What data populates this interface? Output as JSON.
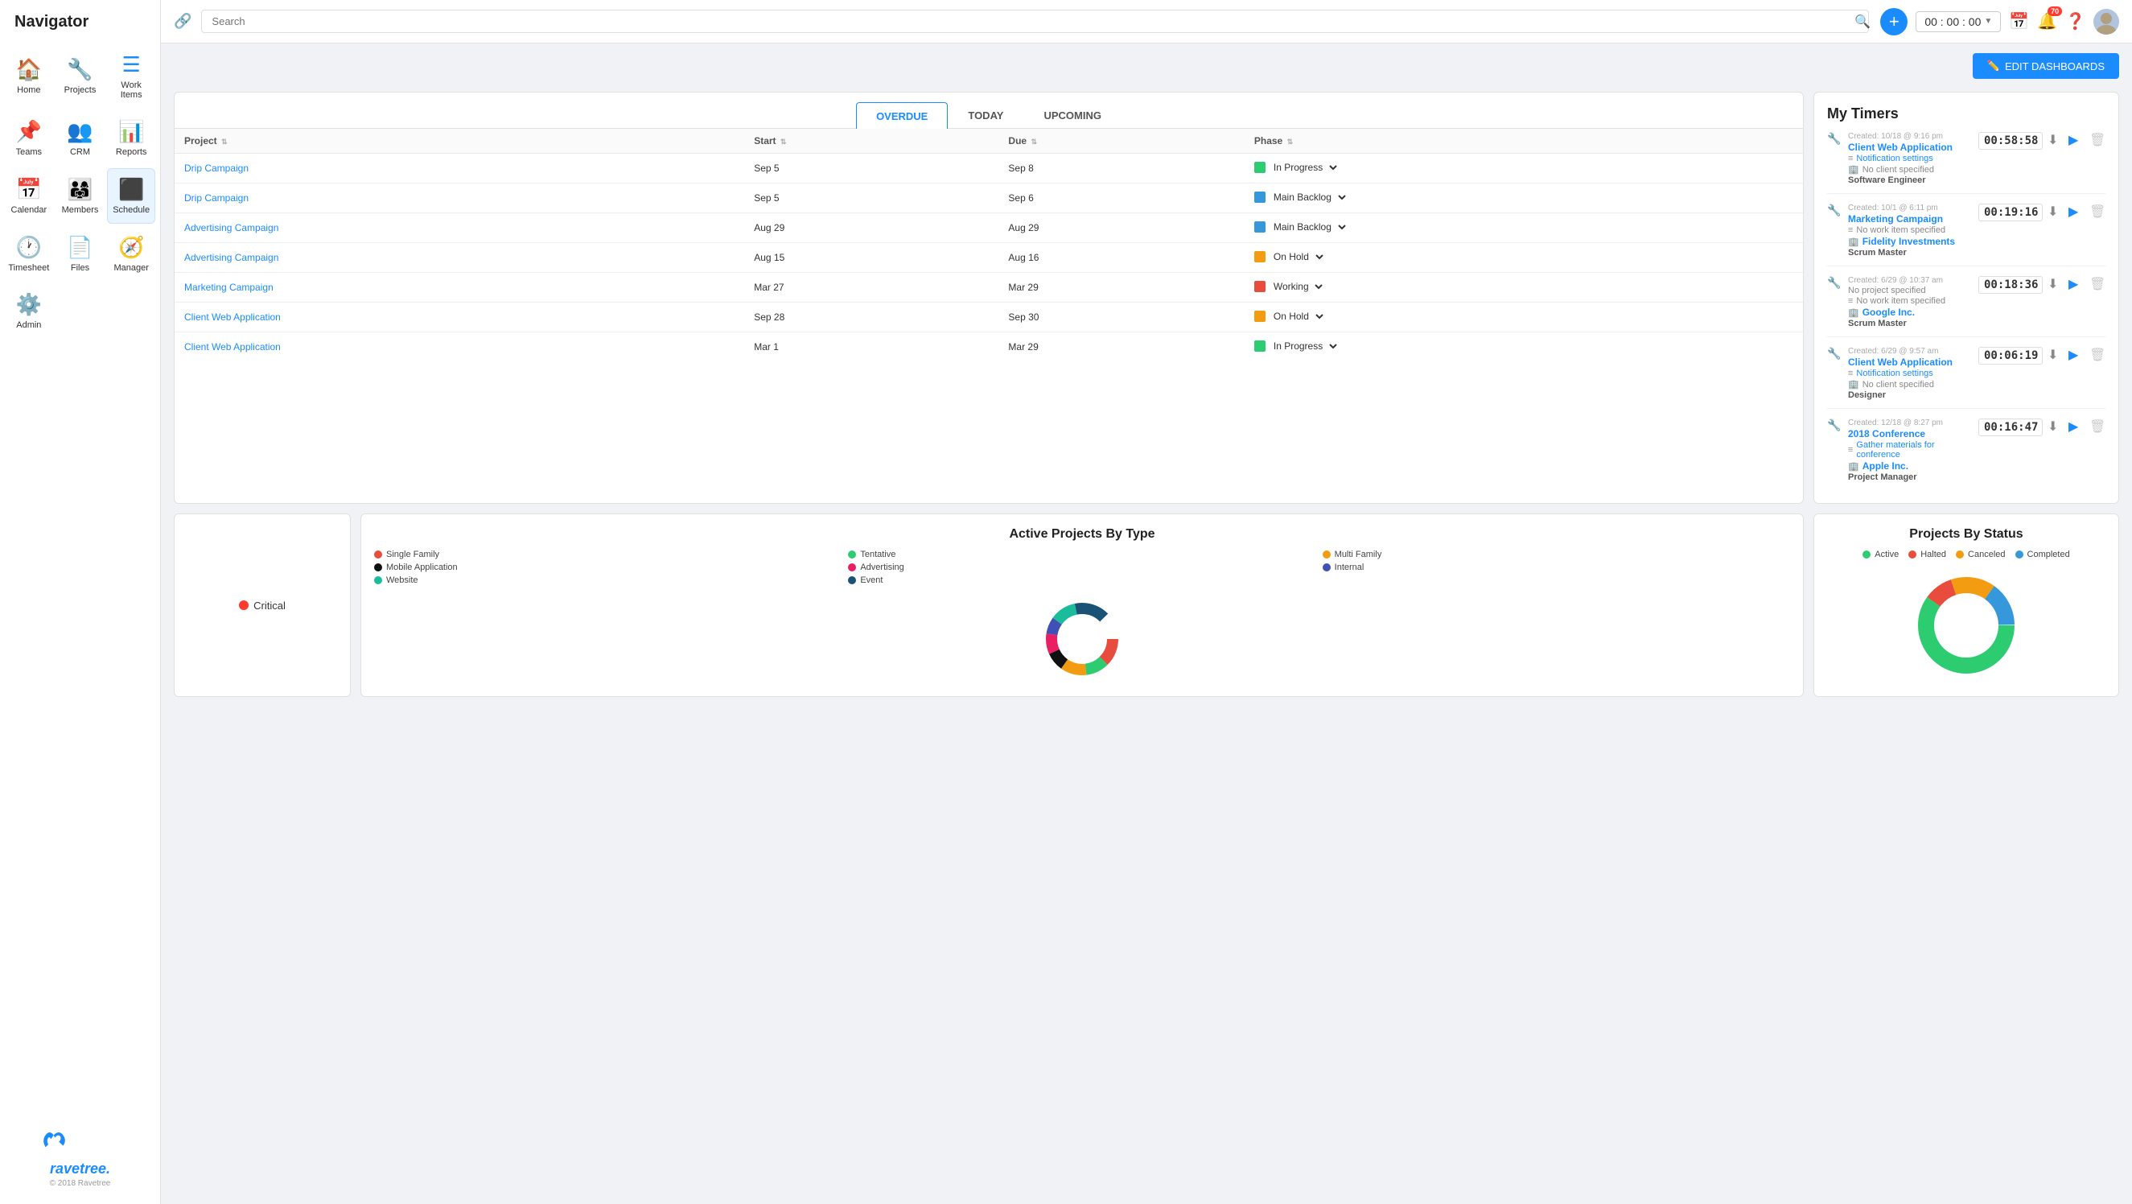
{
  "app": {
    "title": "Navigator"
  },
  "sidebar": {
    "items": [
      {
        "id": "home",
        "label": "Home",
        "icon": "🏠"
      },
      {
        "id": "projects",
        "label": "Projects",
        "icon": "🔧"
      },
      {
        "id": "work-items",
        "label": "Work Items",
        "icon": "☰"
      },
      {
        "id": "teams",
        "label": "Teams",
        "icon": "📌"
      },
      {
        "id": "crm",
        "label": "CRM",
        "icon": "👥"
      },
      {
        "id": "reports",
        "label": "Reports",
        "icon": "📊"
      },
      {
        "id": "calendar",
        "label": "Calendar",
        "icon": "📅"
      },
      {
        "id": "members",
        "label": "Members",
        "icon": "👨‍👩‍👧"
      },
      {
        "id": "schedule",
        "label": "Schedule",
        "icon": "⬛"
      },
      {
        "id": "timesheet",
        "label": "Timesheet",
        "icon": "🕐"
      },
      {
        "id": "files",
        "label": "Files",
        "icon": "📄"
      },
      {
        "id": "manager",
        "label": "Manager",
        "icon": "🧭"
      },
      {
        "id": "admin",
        "label": "Admin",
        "icon": "⚙️"
      }
    ],
    "footer": {
      "logo": "ravetree.",
      "copyright": "© 2018 Ravetree"
    }
  },
  "topbar": {
    "search_placeholder": "Search",
    "timer": "00 : 00 : 00",
    "notification_count": "70",
    "edit_dashboards_label": "EDIT DASHBOARDS"
  },
  "work_items": {
    "tabs": [
      "OVERDUE",
      "TODAY",
      "UPCOMING"
    ],
    "active_tab": "OVERDUE",
    "columns": [
      "Project",
      "Start",
      "Due",
      "Phase"
    ],
    "rows": [
      {
        "project": "Drip Campaign",
        "start": "Sep 5",
        "due": "Sep 8",
        "phase": "In Progress",
        "phase_color": "#2ecc71"
      },
      {
        "project": "Drip Campaign",
        "start": "Sep 5",
        "due": "Sep 6",
        "phase": "Main Backlog",
        "phase_color": "#3498db"
      },
      {
        "project": "Advertising Campaign",
        "start": "Aug 29",
        "due": "Aug 29",
        "phase": "Main Backlog",
        "phase_color": "#3498db"
      },
      {
        "project": "Advertising Campaign",
        "start": "Aug 15",
        "due": "Aug 16",
        "phase": "On Hold",
        "phase_color": "#f39c12"
      },
      {
        "project": "Marketing Campaign",
        "start": "Mar 27",
        "due": "Mar 29",
        "phase": "Working",
        "phase_color": "#e74c3c"
      },
      {
        "project": "Client Web Application",
        "start": "Sep 28",
        "due": "Sep 30",
        "phase": "On Hold",
        "phase_color": "#f39c12"
      },
      {
        "project": "Client Web Application",
        "start": "Mar 1",
        "due": "Mar 29",
        "phase": "In Progress",
        "phase_color": "#2ecc71"
      }
    ]
  },
  "my_timers": {
    "title": "My Timers",
    "timers": [
      {
        "project": "Client Web Application",
        "workitem": "Notification settings",
        "client": "No client specified",
        "created": "Created: 10/18 @ 9:16 pm",
        "time": "00:58:58",
        "role": "Software Engineer"
      },
      {
        "project": "Marketing Campaign",
        "workitem": "No work item specified",
        "client": "Fidelity Investments",
        "created": "Created: 10/1 @ 6:11 pm",
        "time": "00:19:16",
        "role": "Scrum Master"
      },
      {
        "project": "No project specified",
        "workitem": "No work item specified",
        "client": "Google Inc.",
        "created": "Created: 6/29 @ 10:37 am",
        "time": "00:18:36",
        "role": "Scrum Master"
      },
      {
        "project": "Client Web Application",
        "workitem": "Notification settings",
        "client": "No client specified",
        "created": "Created: 6/29 @ 9:57 am",
        "time": "00:06:19",
        "role": "Designer"
      },
      {
        "project": "2018 Conference",
        "workitem": "Gather materials for conference",
        "client": "Apple Inc.",
        "created": "Created: 12/18 @ 8:27 pm",
        "time": "00:16:47",
        "role": "Project Manager"
      }
    ]
  },
  "active_projects": {
    "title": "Active Projects By Type",
    "legend": [
      {
        "label": "Single Family",
        "color": "#e74c3c"
      },
      {
        "label": "Tentative",
        "color": "#2ecc71"
      },
      {
        "label": "Multi Family",
        "color": "#f39c12"
      },
      {
        "label": "Mobile Application",
        "color": "#111"
      },
      {
        "label": "Advertising",
        "color": "#e91e63"
      },
      {
        "label": "Internal",
        "color": "#3f51b5"
      },
      {
        "label": "Website",
        "color": "#1abc9c"
      },
      {
        "label": "Event",
        "color": "#1a5276"
      }
    ]
  },
  "projects_by_status": {
    "title": "Projects By Status",
    "legend": [
      {
        "label": "Active",
        "color": "#2ecc71"
      },
      {
        "label": "Halted",
        "color": "#e74c3c"
      },
      {
        "label": "Canceled",
        "color": "#f39c12"
      },
      {
        "label": "Completed",
        "color": "#3498db"
      }
    ],
    "segments": [
      {
        "label": "Active",
        "value": 60,
        "color": "#2ecc71"
      },
      {
        "label": "Halted",
        "value": 10,
        "color": "#e74c3c"
      },
      {
        "label": "Canceled",
        "value": 15,
        "color": "#f39c12"
      },
      {
        "label": "Completed",
        "value": 15,
        "color": "#3498db"
      }
    ]
  },
  "critical": {
    "label": "Critical"
  }
}
